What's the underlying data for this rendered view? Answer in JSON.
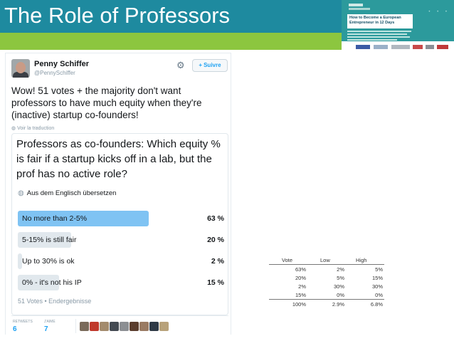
{
  "slide": {
    "title": "The Role of Professors",
    "colors": {
      "header": "#1e8a9f",
      "accent_green": "#8cc63f"
    }
  },
  "promo": {
    "book_title": "How to Become a European Entrepreneur in 12 Days"
  },
  "tweet": {
    "user_name": "Penny Schiffer",
    "user_handle": "@PennySchiffer",
    "follow_label": "Suivre",
    "text": "Wow! 51 votes + the majority don't want professors to have much equity when they're (inactive) startup co-founders!",
    "translate_label": "Voir la traduction",
    "poll": {
      "question": "Professors as co-founders: Which equity % is fair if a startup kicks off in a lab, but the prof has no active role?",
      "translate_label": "Aus dem Englisch übersetzen",
      "options": [
        {
          "label": "No more than 2-5%",
          "percent": "63 %",
          "fill": 0.63,
          "winner": true
        },
        {
          "label": "5-15% is still fair",
          "percent": "20 %",
          "fill": 0.2,
          "winner": false
        },
        {
          "label": "Up to 30% is ok",
          "percent": "2 %",
          "fill": 0.02,
          "winner": false
        },
        {
          "label": "0% - it's not his IP",
          "percent": "15 %",
          "fill": 0.15,
          "winner": false
        }
      ],
      "footer": "51 Votes • Endergebnisse"
    },
    "stats": {
      "retweets_label": "RETWEETS",
      "retweets_value": "6",
      "likes_label": "J'AIME",
      "likes_value": "7"
    }
  },
  "table": {
    "headers": [
      "Vote",
      "Low",
      "High"
    ],
    "rows": [
      [
        "63%",
        "2%",
        "5%"
      ],
      [
        "20%",
        "5%",
        "15%"
      ],
      [
        "2%",
        "30%",
        "30%"
      ],
      [
        "15%",
        "0%",
        "0%"
      ]
    ],
    "total": [
      "100%",
      "2.9%",
      "6.8%"
    ]
  }
}
